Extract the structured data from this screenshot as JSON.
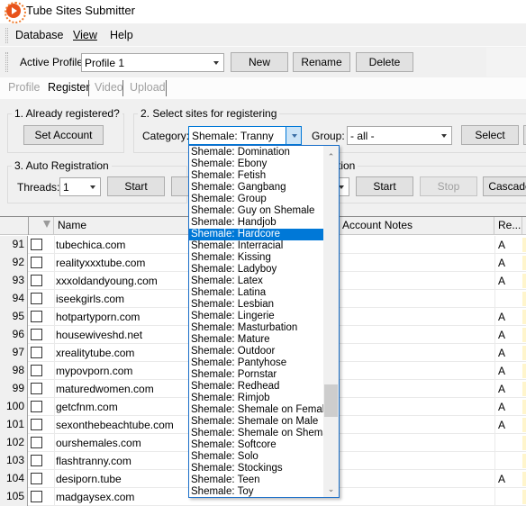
{
  "window": {
    "title": "Tube Sites Submitter",
    "icon": "app-logo-icon"
  },
  "menu": [
    "Database",
    "View",
    "Help"
  ],
  "toolbar": {
    "active_profile_label": "Active Profile:",
    "active_profile_value": "Profile 1",
    "new_label": "New",
    "rename_label": "Rename",
    "delete_label": "Delete"
  },
  "tabs": [
    {
      "label": "Profile",
      "active": false
    },
    {
      "label": "Register",
      "active": true
    },
    {
      "label": "Video",
      "active": false
    },
    {
      "label": "Upload",
      "active": false
    }
  ],
  "section1": {
    "title": "1. Already registered?",
    "set_account_label": "Set Account"
  },
  "section2": {
    "title": "2. Select sites for registering",
    "category_label": "Category:",
    "category_value": "Shemale: Tranny",
    "group_label": "Group:",
    "group_value": "- all -",
    "select_label": "Select"
  },
  "section3": {
    "title": "3. Auto Registration",
    "threads_label": "Threads:",
    "threads_value": "1",
    "start_label": "Start"
  },
  "section4": {
    "title_partial": "tion",
    "start_label": "Start",
    "stop_label": "Stop",
    "cascade_label": "Cascade"
  },
  "grid": {
    "columns": {
      "filter_icon": "filter-icon",
      "name": "Name",
      "account_notes": "Account Notes",
      "re": "Re..."
    },
    "rows": [
      {
        "num": "91",
        "name": "tubechica.com",
        "flag": "A"
      },
      {
        "num": "92",
        "name": "realityxxxtube.com",
        "flag": "A"
      },
      {
        "num": "93",
        "name": "xxxoldandyoung.com",
        "flag": "A"
      },
      {
        "num": "94",
        "name": "iseekgirls.com",
        "flag": ""
      },
      {
        "num": "95",
        "name": "hotpartyporn.com",
        "flag": "A"
      },
      {
        "num": "96",
        "name": "housewiveshd.net",
        "flag": "A"
      },
      {
        "num": "97",
        "name": "xrealitytube.com",
        "flag": "A"
      },
      {
        "num": "98",
        "name": "mypovporn.com",
        "flag": "A"
      },
      {
        "num": "99",
        "name": "maturedwomen.com",
        "flag": "A"
      },
      {
        "num": "100",
        "name": "getcfnm.com",
        "flag": "A"
      },
      {
        "num": "101",
        "name": "sexonthebeachtube.com",
        "flag": "A"
      },
      {
        "num": "102",
        "name": "ourshemales.com",
        "flag": ""
      },
      {
        "num": "103",
        "name": "flashtranny.com",
        "flag": ""
      },
      {
        "num": "104",
        "name": "desiporn.tube",
        "flag": "A"
      },
      {
        "num": "105",
        "name": "madgaysex.com",
        "flag": ""
      }
    ]
  },
  "category_dropdown": {
    "selected": "Shemale: Hardcore",
    "scroll_position": 0.78,
    "items": [
      "Shemale: Domination",
      "Shemale: Ebony",
      "Shemale: Fetish",
      "Shemale: Gangbang",
      "Shemale: Group",
      "Shemale: Guy on Shemale",
      "Shemale: Handjob",
      "Shemale: Hardcore",
      "Shemale: Interracial",
      "Shemale: Kissing",
      "Shemale: Ladyboy",
      "Shemale: Latex",
      "Shemale: Latina",
      "Shemale: Lesbian",
      "Shemale: Lingerie",
      "Shemale: Masturbation",
      "Shemale: Mature",
      "Shemale: Outdoor",
      "Shemale: Pantyhose",
      "Shemale: Pornstar",
      "Shemale: Redhead",
      "Shemale: Rimjob",
      "Shemale: Shemale on Female",
      "Shemale: Shemale on Male",
      "Shemale: Shemale on Shemale",
      "Shemale: Softcore",
      "Shemale: Solo",
      "Shemale: Stockings",
      "Shemale: Teen",
      "Shemale: Toy"
    ]
  }
}
